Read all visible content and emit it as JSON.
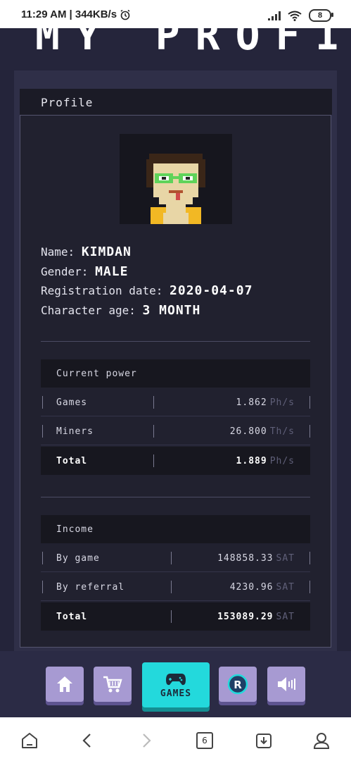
{
  "status_bar": {
    "time": "11:29 AM",
    "speed": "| 344KB/s",
    "battery": "8"
  },
  "page": {
    "title": "MY PROFILE"
  },
  "profile": {
    "header": "Profile",
    "name_label": "Name:",
    "name_value": "KIMDAN",
    "gender_label": "Gender:",
    "gender_value": "MALE",
    "registration_label": "Registration date:",
    "registration_value": "2020-04-07",
    "age_label": "Character age:",
    "age_value": "3  MONTH"
  },
  "power": {
    "header": "Current power",
    "rows": [
      {
        "label": "Games",
        "value": "1.862",
        "unit": "Ph/s"
      },
      {
        "label": "Miners",
        "value": "26.800",
        "unit": "Th/s"
      },
      {
        "label": "Total",
        "value": "1.889",
        "unit": "Ph/s"
      }
    ]
  },
  "income": {
    "header": "Income",
    "rows": [
      {
        "label": "By game",
        "value": "148858.33",
        "unit": "SAT"
      },
      {
        "label": "By referral",
        "value": "4230.96",
        "unit": "SAT"
      },
      {
        "label": "Total",
        "value": "153089.29",
        "unit": "SAT"
      }
    ]
  },
  "nav": {
    "items": [
      "home-icon",
      "cart-icon",
      "gamepad-icon",
      "rollercoin-icon",
      "speaker-icon"
    ],
    "games_label": "GAMES"
  },
  "android_nav": {
    "tabs_count": "6"
  }
}
